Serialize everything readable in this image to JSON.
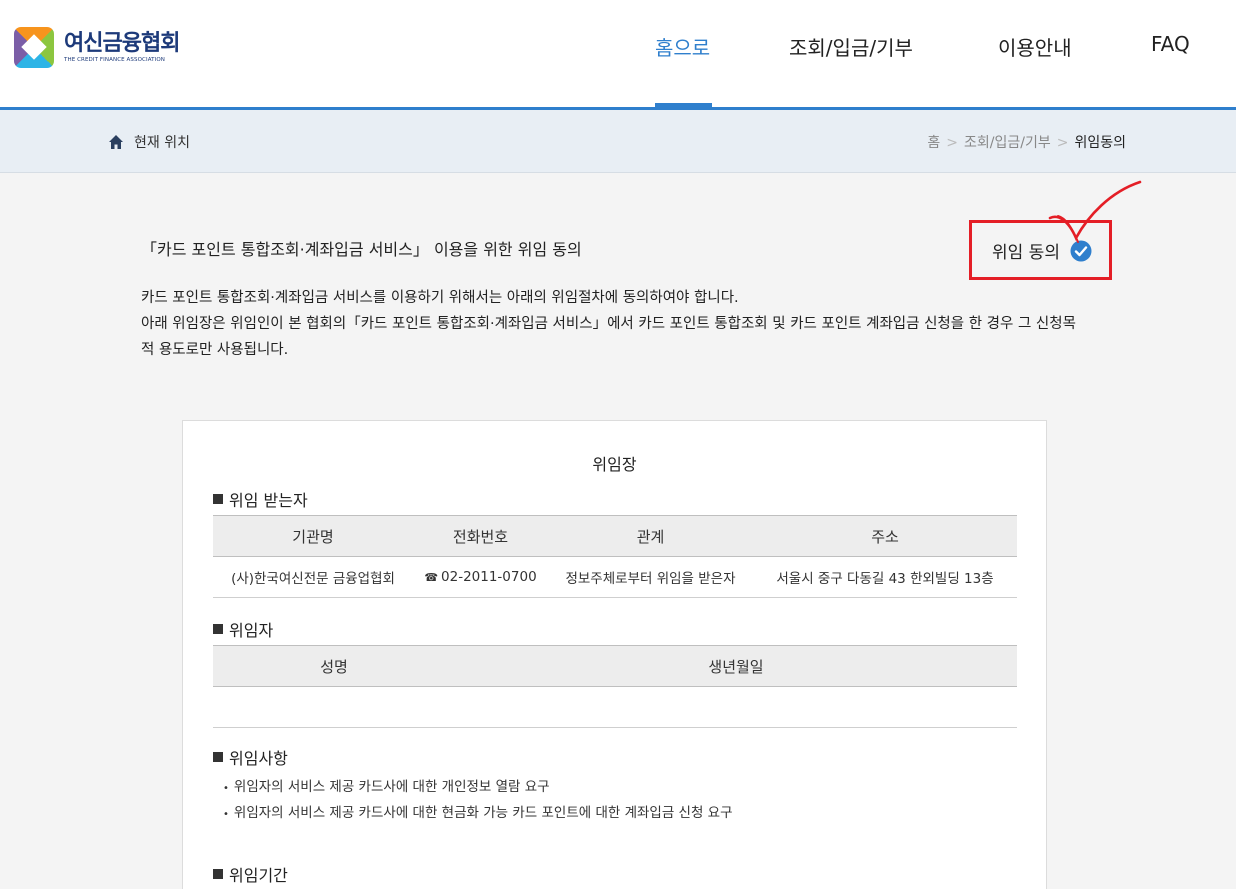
{
  "header": {
    "logo_kr": "여신금융협회",
    "logo_en": "THE CREDIT FINANCE ASSOCIATION",
    "nav": [
      {
        "label": "홈으로",
        "active": true
      },
      {
        "label": "조회/입금/기부",
        "active": false
      },
      {
        "label": "이용안내",
        "active": false
      },
      {
        "label": "FAQ",
        "active": false
      }
    ]
  },
  "breadcrumb": {
    "home_label": "현재 위치",
    "path": [
      "홈",
      "조회/입금/기부",
      "위임동의"
    ],
    "separator": ">"
  },
  "intro": {
    "title": "「카드 포인트 통합조회·계좌입금 서비스」 이용을 위한 위임 동의",
    "agree_label": "위임 동의",
    "agree_checked": true,
    "desc_line1": "카드 포인트 통합조회·계좌입금 서비스를 이용하기 위해서는 아래의 위임절차에 동의하여야 합니다.",
    "desc_line2": "아래 위임장은 위임인이 본 협회의「카드 포인트 통합조회·계좌입금 서비스」에서 카드 포인트 통합조회 및 카드 포인트 계좌입금 신청을 한 경우 그 신청목적 용도로만 사용됩니다."
  },
  "document": {
    "title": "위임장",
    "delegate_section": {
      "title": "위임 받는자",
      "headers": [
        "기관명",
        "전화번호",
        "관계",
        "주소"
      ],
      "row": [
        "(사)한국여신전문 금융업협회",
        "02-2011-0700",
        "정보주체로부터 위임을 받은자",
        "서울시 중구 다동길 43 한외빌딩 13층"
      ]
    },
    "delegator_section": {
      "title": "위임자",
      "headers": [
        "성명",
        "생년월일"
      ],
      "row": [
        "",
        ""
      ]
    },
    "matters_section": {
      "title": "위임사항",
      "items": [
        "위임자의 서비스 제공 카드사에 대한 개인정보 열람 요구",
        "위임자의 서비스 제공 카드사에 대한 현금화 가능 카드 포인트에 대한 계좌입금 신청 요구"
      ]
    },
    "period_section": {
      "title": "위임기간"
    }
  },
  "colors": {
    "accent": "#2f7fcd",
    "annotation": "#e41e26",
    "logo_text": "#1d3a7a"
  }
}
